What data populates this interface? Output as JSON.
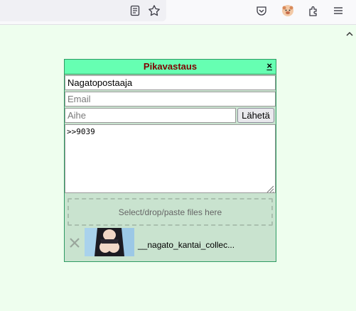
{
  "browser": {
    "icons": [
      "reader-view-icon",
      "bookmark-star-icon",
      "pocket-icon",
      "profile-avatar-icon",
      "extensions-icon",
      "menu-icon"
    ]
  },
  "quick_reply": {
    "title": "Pikavastaus",
    "close_label": "×",
    "name_value": "Nagatopostaaja",
    "email_placeholder": "Email",
    "subject_placeholder": "Aihe",
    "send_label": "Lähetä",
    "comment_value": ">>9039",
    "dropzone_label": "Select/drop/paste files here",
    "files": [
      {
        "name": "__nagato_kantai_collec..."
      }
    ]
  },
  "colors": {
    "page_background": "#eefeee",
    "header_background": "#66ffb2",
    "title_color": "#800000",
    "box_background": "#c9e3cf"
  }
}
